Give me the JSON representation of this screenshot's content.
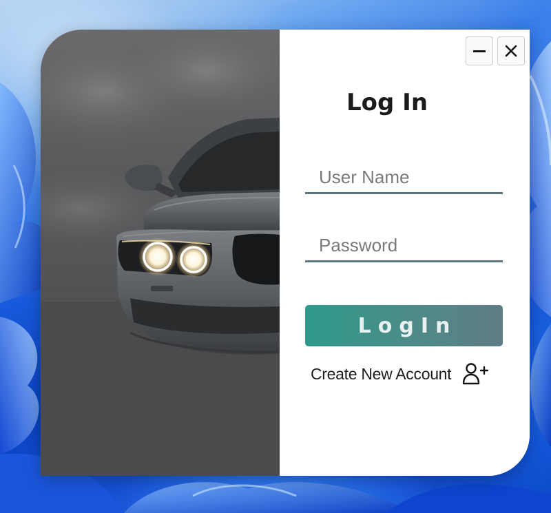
{
  "window": {
    "title": "Log In",
    "minimize_icon": "minimize-icon",
    "close_icon": "close-icon"
  },
  "form": {
    "username": {
      "value": "",
      "placeholder": "User Name"
    },
    "password": {
      "value": "",
      "placeholder": "Password"
    },
    "login_button_label": "LogIn",
    "create_account_label": "Create New Account",
    "create_account_icon": "add-user-icon"
  },
  "colors": {
    "button_gradient_start": "#2e9a8c",
    "button_gradient_end": "#607c86",
    "field_underline": "#5e7480",
    "hero_background": "#545456"
  }
}
